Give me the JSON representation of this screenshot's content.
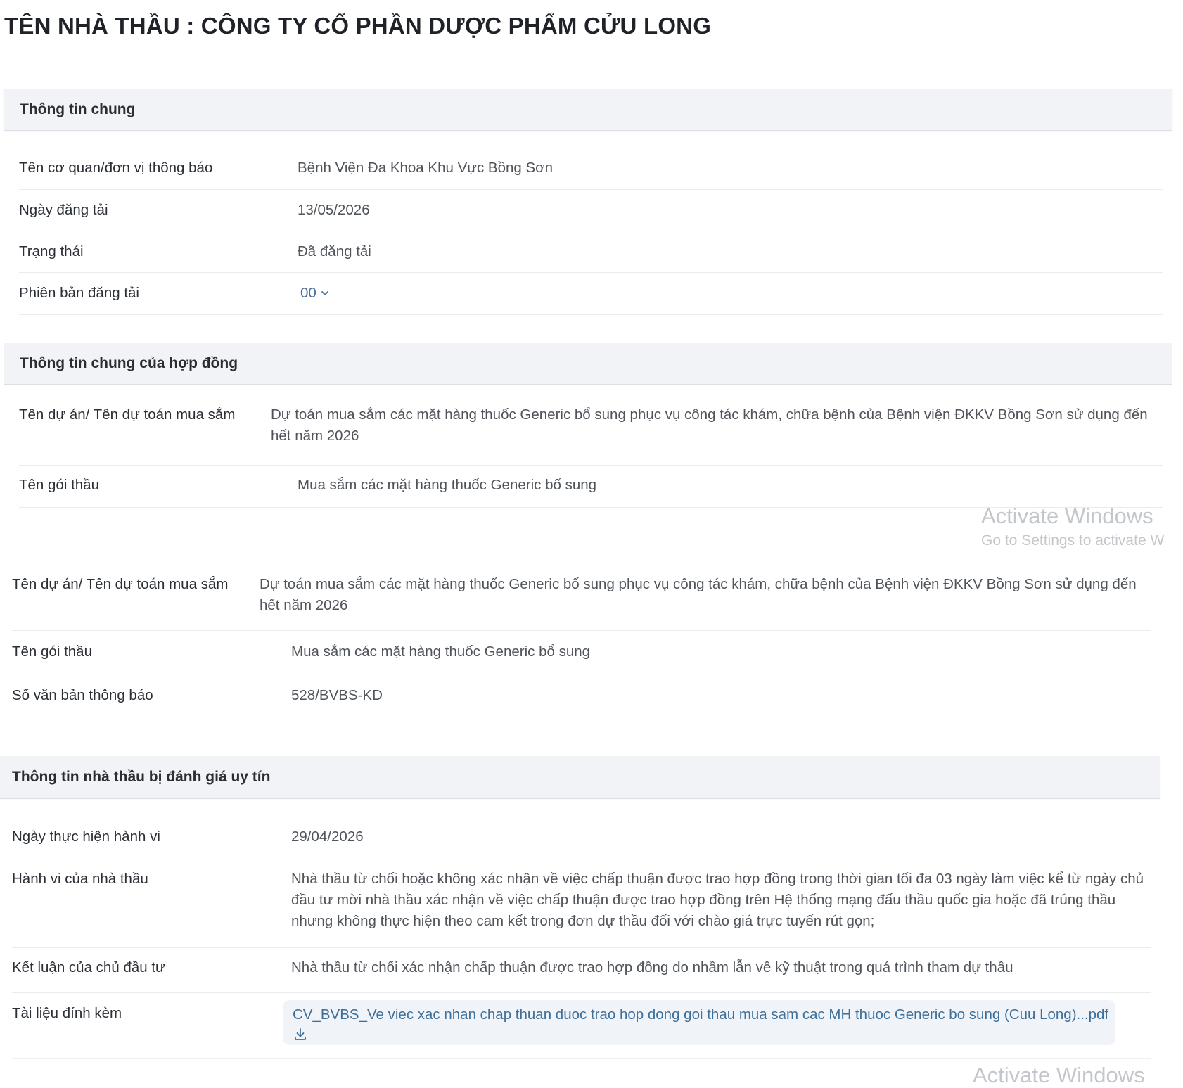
{
  "page_title": "TÊN NHÀ THẦU : CÔNG TY CỔ PHẦN DƯỢC PHẨM CỬU LONG",
  "general_info": {
    "header": "Thông tin chung",
    "rows": [
      {
        "label": "Tên cơ quan/đơn vị thông báo",
        "value": "Bệnh Viện Đa Khoa Khu Vực Bồng Sơn"
      },
      {
        "label": "Ngày đăng tải",
        "value": "13/05/2026"
      },
      {
        "label": "Trạng thái",
        "value": "Đã đăng tải"
      },
      {
        "label": "Phiên bản đăng tải",
        "value": "00"
      }
    ]
  },
  "contract_info": {
    "header": "Thông tin chung của hợp đồng",
    "rows": [
      {
        "label": "Tên dự án/ Tên dự toán mua sắm",
        "value": "Dự toán mua sắm các mặt hàng thuốc Generic bổ sung phục vụ công tác khám, chữa bệnh của Bệnh viện ĐKKV Bồng Sơn sử dụng đến hết năm 2026"
      },
      {
        "label": "Tên gói thầu",
        "value": "Mua sắm các mặt hàng thuốc Generic bổ sung"
      }
    ]
  },
  "contract_info_overlay": {
    "rows": [
      {
        "label": "Tên dự án/ Tên dự toán mua sắm",
        "value": "Dự toán mua sắm các mặt hàng thuốc Generic bổ sung phục vụ công tác khám, chữa bệnh của Bệnh viện ĐKKV Bồng Sơn sử dụng đến hết năm 2026"
      },
      {
        "label": "Tên gói thầu",
        "value": "Mua sắm các mặt hàng thuốc Generic bổ sung"
      },
      {
        "label": "Số văn bản thông báo",
        "value": "528/BVBS-KD"
      }
    ]
  },
  "reputation_info": {
    "header": "Thông tin nhà thầu bị đánh giá uy tín",
    "rows": [
      {
        "label": "Ngày thực hiện hành vi",
        "value": "29/04/2026"
      },
      {
        "label": "Hành vi của nhà thầu",
        "value": "Nhà thầu từ chối hoặc không xác nhận về việc chấp thuận được trao hợp đồng trong thời gian tối đa 03 ngày làm việc kể từ ngày chủ đầu tư mời nhà thầu xác nhận về việc chấp thuận được trao hợp đồng trên Hệ thống mạng đấu thầu quốc gia hoặc đã trúng thầu nhưng không thực hiện theo cam kết trong đơn dự thầu đối với chào giá trực tuyến rút gọn;"
      },
      {
        "label": "Kết luận của chủ đầu tư",
        "value": "Nhà thầu từ chối xác nhận chấp thuận được trao hợp đồng do nhầm lẫn về kỹ thuật trong quá trình tham dự thầu"
      },
      {
        "label": "Tài liệu đính kèm",
        "value": "CV_BVBS_Ve viec xac nhan chap thuan duoc trao hop dong goi thau mua sam cac MH thuoc Generic bo sung (Cuu Long)...pdf"
      }
    ]
  },
  "watermark": {
    "title": "Activate Windows",
    "subtitle": "Go to Settings to activate W"
  },
  "icons": {
    "version_dropdown": "chevron-down-icon",
    "attachment_download": "download-icon"
  }
}
